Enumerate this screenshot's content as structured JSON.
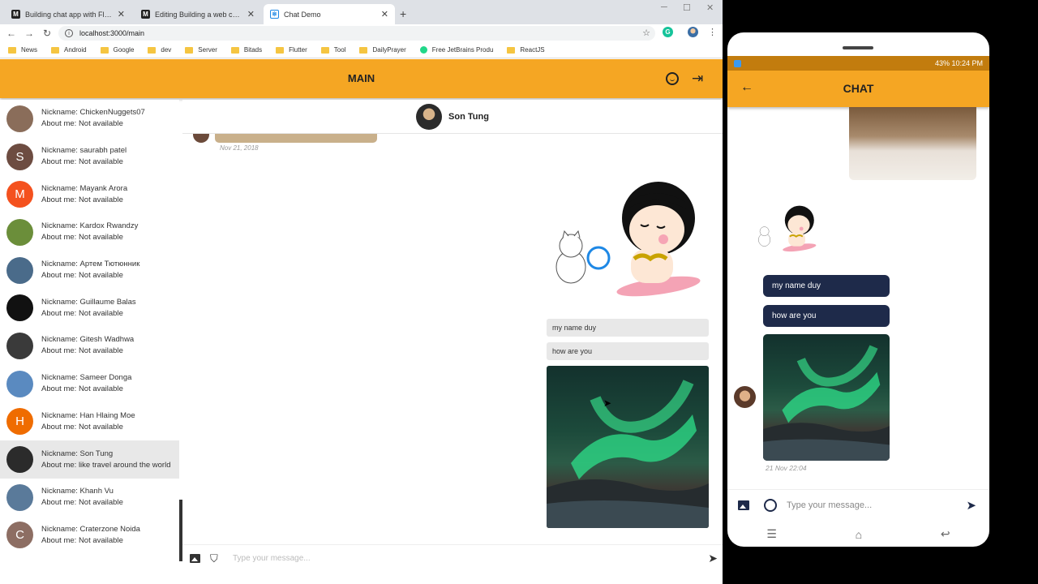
{
  "browser": {
    "tabs": [
      {
        "title": "Building chat app with Flutter and",
        "favicon": "M"
      },
      {
        "title": "Editing Building a web chat with",
        "favicon": "M"
      },
      {
        "title": "Chat Demo",
        "favicon": "react"
      }
    ],
    "url": "localhost:3000/main",
    "bookmarks": [
      "News",
      "Android",
      "Google",
      "dev",
      "Server",
      "Bitads",
      "Flutter",
      "Tool",
      "DailyPrayer",
      "Free JetBrains Produ",
      "ReactJS"
    ]
  },
  "web": {
    "title": "MAIN",
    "users": [
      {
        "nickname": "Nickname: ChickenNuggets07",
        "about": "About me: Not available",
        "avatar_letter": "",
        "avatar_color": "#8a6d5a"
      },
      {
        "nickname": "Nickname: saurabh patel",
        "about": "About me: Not available",
        "avatar_letter": "S",
        "avatar_color": "#6d4c41"
      },
      {
        "nickname": "Nickname: Mayank Arora",
        "about": "About me: Not available",
        "avatar_letter": "M",
        "avatar_color": "#f4511e"
      },
      {
        "nickname": "Nickname: Kardox Rwandzy",
        "about": "About me: Not available",
        "avatar_letter": "",
        "avatar_color": "#6b8e3a"
      },
      {
        "nickname": "Nickname: Артем Тютюнник",
        "about": "About me: Not available",
        "avatar_letter": "",
        "avatar_color": "#4a6b8a"
      },
      {
        "nickname": "Nickname: Guillaume Balas",
        "about": "About me: Not available",
        "avatar_letter": "",
        "avatar_color": "#111111"
      },
      {
        "nickname": "Nickname: Gitesh Wadhwa",
        "about": "About me: Not available",
        "avatar_letter": "",
        "avatar_color": "#3a3a3a"
      },
      {
        "nickname": "Nickname: Sameer Donga",
        "about": "About me: Not available",
        "avatar_letter": "",
        "avatar_color": "#5a8ac0"
      },
      {
        "nickname": "Nickname: Han Hlaing Moe",
        "about": "About me: Not available",
        "avatar_letter": "H",
        "avatar_color": "#ef6c00"
      },
      {
        "nickname": "Nickname: Son Tung",
        "about": "About me: like travel around the world",
        "avatar_letter": "",
        "avatar_color": "#2b2b2b"
      },
      {
        "nickname": "Nickname: Khanh Vu",
        "about": "About me: Not available",
        "avatar_letter": "",
        "avatar_color": "#5a7a9a"
      },
      {
        "nickname": "Nickname: Craterzone Noida",
        "about": "About me: Not available",
        "avatar_letter": "C",
        "avatar_color": "#8d6e63"
      }
    ],
    "selected_user_index": 9,
    "chat": {
      "peer_name": "Son Tung",
      "old_time": "Nov 21, 2018",
      "messages": [
        "my name duy",
        "how are you"
      ],
      "input_placeholder": "Type your message..."
    }
  },
  "phone": {
    "status_right": "43% 10:24 PM",
    "title": "CHAT",
    "messages": [
      "my name duy",
      "how are you"
    ],
    "time": "21 Nov 22:04",
    "input_placeholder": "Type your message..."
  },
  "colors": {
    "accent": "#f5a623",
    "phone_bubble": "#1e2a4a"
  }
}
